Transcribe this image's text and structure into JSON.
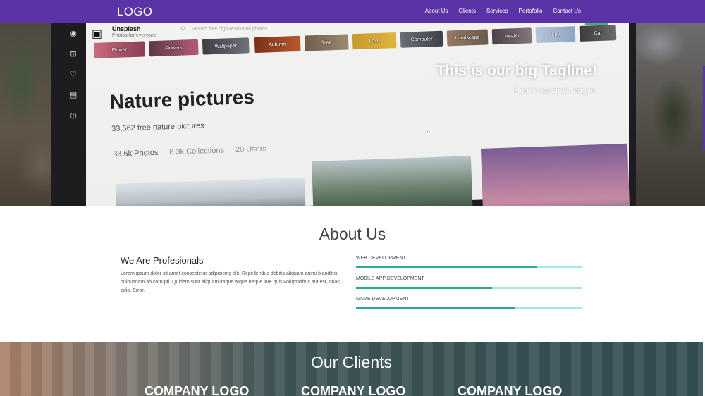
{
  "navbar": {
    "logo": "LOGO",
    "links": [
      "About Us",
      "Clients",
      "Services",
      "Portofolio",
      "Contact Us"
    ]
  },
  "hero": {
    "tagline": "This is our big Tagline!",
    "slogan": "Here's our small slogan.",
    "screen": {
      "brand_name": "Unsplash",
      "brand_sub": "Photos for everyone",
      "search_placeholder": "Search free high-resolution photos",
      "chips": [
        "Flower",
        "Flowers",
        "Wallpaper",
        "Autumn",
        "Tree",
        "Love",
        "Computer",
        "Landscape",
        "Health",
        "Sky",
        "Cat"
      ],
      "title": "Nature pictures",
      "count": "33,562 free nature pictures",
      "stats": [
        "33.6k Photos",
        "8.3k Collections",
        "20 Users"
      ]
    }
  },
  "about": {
    "heading": "About Us",
    "subheading": "We Are Profesionals",
    "text": "Lorem ipsum dolor sit amet consectetur adipisicing elit. Repellendus debitis aliquam animi blanditiis quibusdam ab corrupti. Quidem sunt aliquam itaque atque neque iure quis voluptatibus aut est, quas odio. Error.",
    "skills": [
      {
        "label": "WEB DEVELOPMENT",
        "level": 0.8
      },
      {
        "label": "MOBILE APP DEVELOPMENT",
        "level": 0.6
      },
      {
        "label": "GAME DEVELOPMENT",
        "level": 0.7
      }
    ]
  },
  "clients": {
    "heading": "Our Clients",
    "logos": [
      "COMPANY LOGO",
      "COMPANY LOGO",
      "COMPANY LOGO"
    ]
  },
  "colors": {
    "navbar": "#5a33a6",
    "skill_fill": "#2aa89a",
    "skill_track": "#a8e6ea"
  }
}
